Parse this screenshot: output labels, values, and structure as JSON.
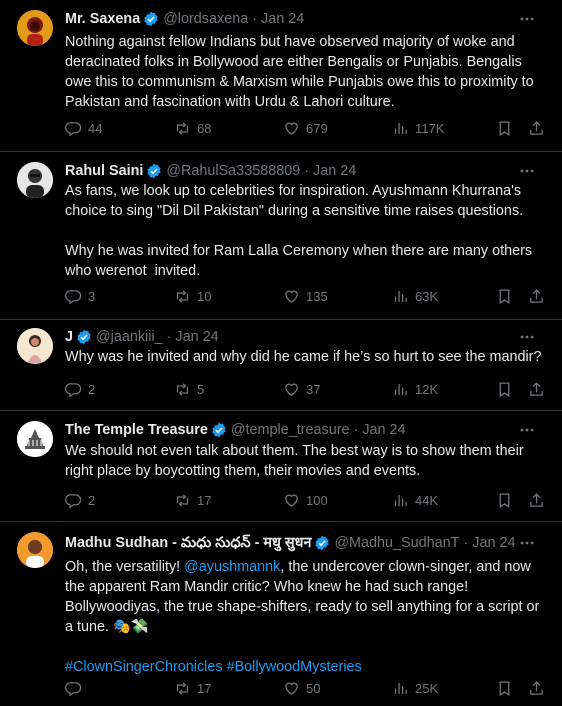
{
  "tweets": [
    {
      "name": "Mr. Saxena",
      "handle": "@lordsaxena",
      "date": "Jan 24",
      "text": "Nothing against fellow Indians but have observed majority of woke and deracinated folks in Bollywood are either Bengalis or Punjabis. Bengalis owe this to communism & Marxism while Punjabis owe this to proximity to Pakistan and fascination with Urdu & Lahori culture.",
      "replies": "44",
      "retweets": "68",
      "likes": "679",
      "views": "117K"
    },
    {
      "name": "Rahul Saini",
      "handle": "@RahulSa33588809",
      "date": "Jan 24",
      "text": "As fans, we look up to celebrities for inspiration. Ayushmann Khurrana's choice to sing \"Dil Dil Pakistan\" during a sensitive time raises questions.\n\nWhy he was invited for Ram Lalla Ceremony when there are many others who werenot  invited.",
      "replies": "3",
      "retweets": "10",
      "likes": "135",
      "views": "63K"
    },
    {
      "name": "J",
      "handle": "@jaankiii_",
      "date": "Jan 24",
      "text": "Why was he invited and why did he came if he’s so hurt to see the mandir?",
      "replies": "2",
      "retweets": "5",
      "likes": "37",
      "views": "12K"
    },
    {
      "name": "The Temple Treasure",
      "handle": "@temple_treasure",
      "date": "Jan 24",
      "text": "We should not even talk about them. The best way is to show them their right place by boycotting them, their movies and events.",
      "replies": "2",
      "retweets": "17",
      "likes": "100",
      "views": "44K"
    },
    {
      "name": "Madhu Sudhan - మధు సుధన్ - मधु सुधन",
      "handle": "@Madhu_SudhanT",
      "date": "Jan 24",
      "text_before": "Oh, the versatility! ",
      "mention": "@ayushmannk",
      "text_after": ", the undercover clown-singer, and now the apparent Ram Mandir critic? Who knew he had such range! Bollywoodiyas, the true shape-shifters, ready to sell anything for a script or a tune. 🎭💸",
      "hashtags": "#ClownSingerChronicles #BollywoodMysteries",
      "replies": "",
      "retweets": "17",
      "likes": "50",
      "views": "25K"
    }
  ],
  "colors": {
    "background": "#000000",
    "text": "#e7e9ea",
    "muted": "#71767b",
    "link": "#1d9bf0",
    "verified": "#1d9bf0",
    "divider": "#2f3336"
  },
  "icons": [
    "reply-icon",
    "retweet-icon",
    "like-icon",
    "views-icon",
    "bookmark-icon",
    "share-icon",
    "more-icon",
    "verified-badge-icon"
  ]
}
